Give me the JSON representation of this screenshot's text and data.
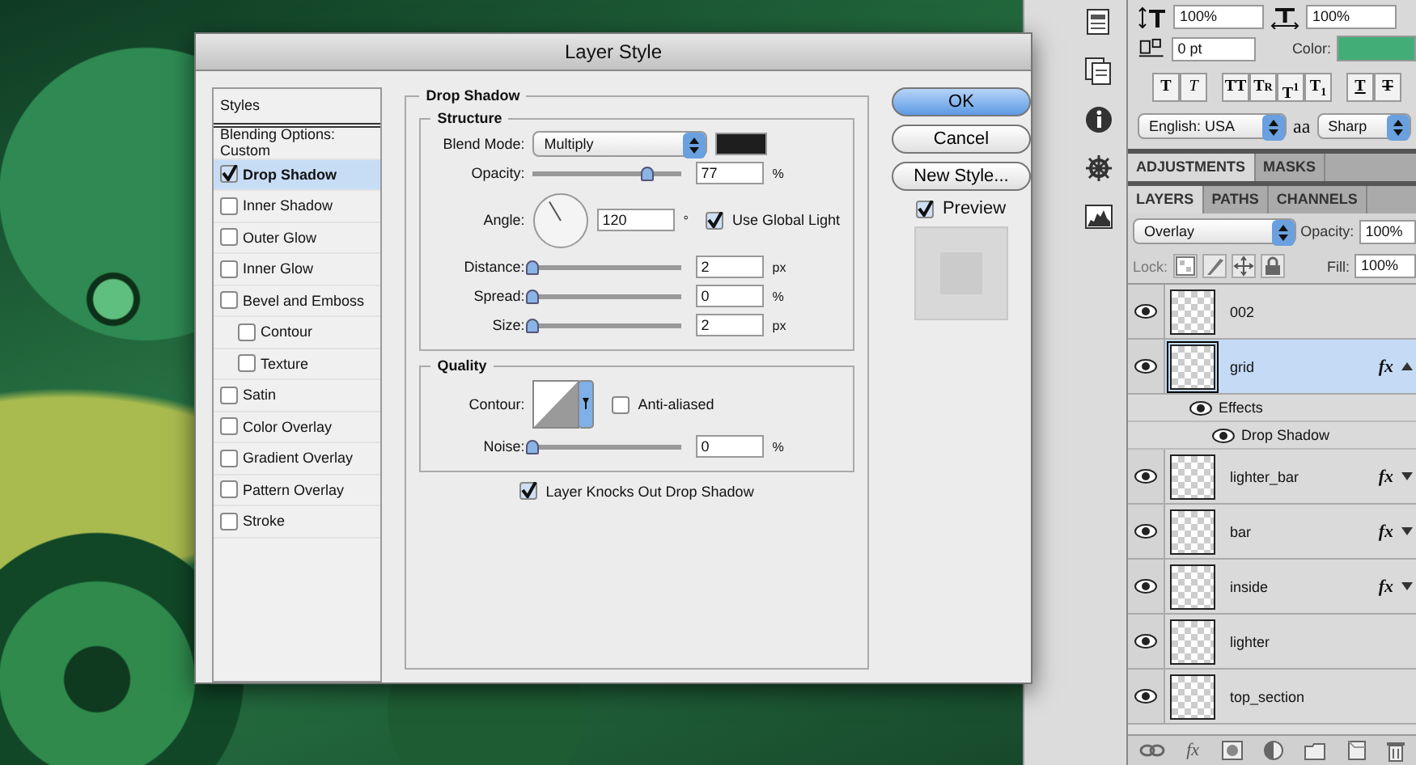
{
  "dialog": {
    "title": "Layer Style",
    "styles_header": "Styles",
    "styles": [
      {
        "label": "Blending Options: Custom",
        "kind": "plain",
        "selected": false
      },
      {
        "label": "Drop Shadow",
        "kind": "check",
        "checked": true,
        "selected": true
      },
      {
        "label": "Inner Shadow",
        "kind": "check",
        "checked": false,
        "selected": false
      },
      {
        "label": "Outer Glow",
        "kind": "check",
        "checked": false,
        "selected": false
      },
      {
        "label": "Inner Glow",
        "kind": "check",
        "checked": false,
        "selected": false
      },
      {
        "label": "Bevel and Emboss",
        "kind": "check",
        "checked": false,
        "selected": false,
        "children": [
          {
            "label": "Contour",
            "kind": "check",
            "checked": false,
            "selected": false
          },
          {
            "label": "Texture",
            "kind": "check",
            "checked": false,
            "selected": false
          }
        ]
      },
      {
        "label": "Satin",
        "kind": "check",
        "checked": false,
        "selected": false
      },
      {
        "label": "Color Overlay",
        "kind": "check",
        "checked": false,
        "selected": false
      },
      {
        "label": "Gradient Overlay",
        "kind": "check",
        "checked": false,
        "selected": false
      },
      {
        "label": "Pattern Overlay",
        "kind": "check",
        "checked": false,
        "selected": false
      },
      {
        "label": "Stroke",
        "kind": "check",
        "checked": false,
        "selected": false
      }
    ],
    "panel": {
      "title": "Drop Shadow",
      "structure": {
        "title": "Structure",
        "blend_mode": {
          "label": "Blend Mode:",
          "value": "Multiply",
          "color": "#1e1e1e"
        },
        "rows": [
          {
            "kind": "slider",
            "label": "Opacity:",
            "level": 0.77,
            "value": "77",
            "unit": "%"
          },
          {
            "kind": "angle",
            "label": "Angle:",
            "value": "120",
            "unit": "°",
            "global_light": {
              "label": "Use Global Light",
              "checked": true
            }
          },
          {
            "kind": "slider",
            "label": "Distance:",
            "level": 0,
            "value": "2",
            "unit": "px"
          },
          {
            "kind": "slider",
            "label": "Spread:",
            "level": 0,
            "value": "0",
            "unit": "%"
          },
          {
            "kind": "slider",
            "label": "Size:",
            "level": 0,
            "value": "2",
            "unit": "px"
          }
        ]
      },
      "quality": {
        "title": "Quality",
        "contour_label": "Contour:",
        "anti_aliased": {
          "label": "Anti-aliased",
          "checked": false
        },
        "noise": {
          "kind": "slider",
          "label": "Noise:",
          "level": 0,
          "value": "0",
          "unit": "%"
        }
      },
      "knockout": {
        "label": "Layer Knocks Out Drop Shadow",
        "checked": true
      }
    },
    "buttons": [
      {
        "label": "OK",
        "default": true
      },
      {
        "label": "Cancel",
        "default": false
      },
      {
        "label": "New Style...",
        "default": false
      }
    ],
    "preview": {
      "label": "Preview",
      "checked": true
    }
  },
  "character": {
    "vertical_scale": "100%",
    "horizontal_scale": "100%",
    "baseline_shift": "0 pt",
    "color_label": "Color:",
    "color": "#43ad78",
    "style_groups": [
      [
        {
          "label": "T",
          "kind": "bold"
        },
        {
          "label": "T",
          "kind": "italic"
        }
      ],
      [
        {
          "label": "TT",
          "kind": "caps"
        },
        {
          "label": "Tr",
          "kind": "smallcaps"
        },
        {
          "label": "T$^{1}$",
          "kind": "super"
        },
        {
          "label": "T$_{1}$",
          "kind": "sub"
        }
      ],
      [
        {
          "label": "T",
          "kind": "underline"
        },
        {
          "label": "T",
          "kind": "strike"
        }
      ]
    ],
    "language": "English: USA",
    "antialias_label": "aa",
    "antialias": "Sharp"
  },
  "adjustments_tabs": [
    {
      "label": "ADJUSTMENTS",
      "selected": true
    },
    {
      "label": "MASKS",
      "selected": false
    }
  ],
  "layers_panel": {
    "tabs": [
      {
        "label": "LAYERS",
        "selected": true
      },
      {
        "label": "PATHS",
        "selected": false
      },
      {
        "label": "CHANNELS",
        "selected": false
      }
    ],
    "blend_mode": "Overlay",
    "opacity_label": "Opacity:",
    "opacity": "100%",
    "lock_label": "Lock:",
    "fill_label": "Fill:",
    "fill": "100%",
    "layers": [
      {
        "name": "002",
        "visible": true,
        "selected": false
      },
      {
        "name": "grid",
        "visible": true,
        "selected": true,
        "fx": "fx",
        "expanded": true,
        "effects": {
          "label": "Effects",
          "visible": true,
          "children": [
            {
              "label": "Drop Shadow",
              "visible": true
            }
          ]
        }
      },
      {
        "name": "lighter_bar",
        "visible": true,
        "selected": false,
        "fx": "fx",
        "expanded": false
      },
      {
        "name": "bar",
        "visible": true,
        "selected": false,
        "fx": "fx",
        "expanded": false
      },
      {
        "name": "inside",
        "visible": true,
        "selected": false,
        "fx": "fx",
        "expanded": false
      },
      {
        "name": "lighter",
        "visible": true,
        "selected": false
      },
      {
        "name": "top_section",
        "visible": true,
        "selected": false
      }
    ],
    "toolbar": [
      {
        "kind": "link"
      },
      {
        "kind": "fx",
        "label": "fx"
      },
      {
        "kind": "mask"
      },
      {
        "kind": "adjustment"
      },
      {
        "kind": "folder"
      },
      {
        "kind": "new"
      },
      {
        "kind": "trash"
      }
    ]
  }
}
